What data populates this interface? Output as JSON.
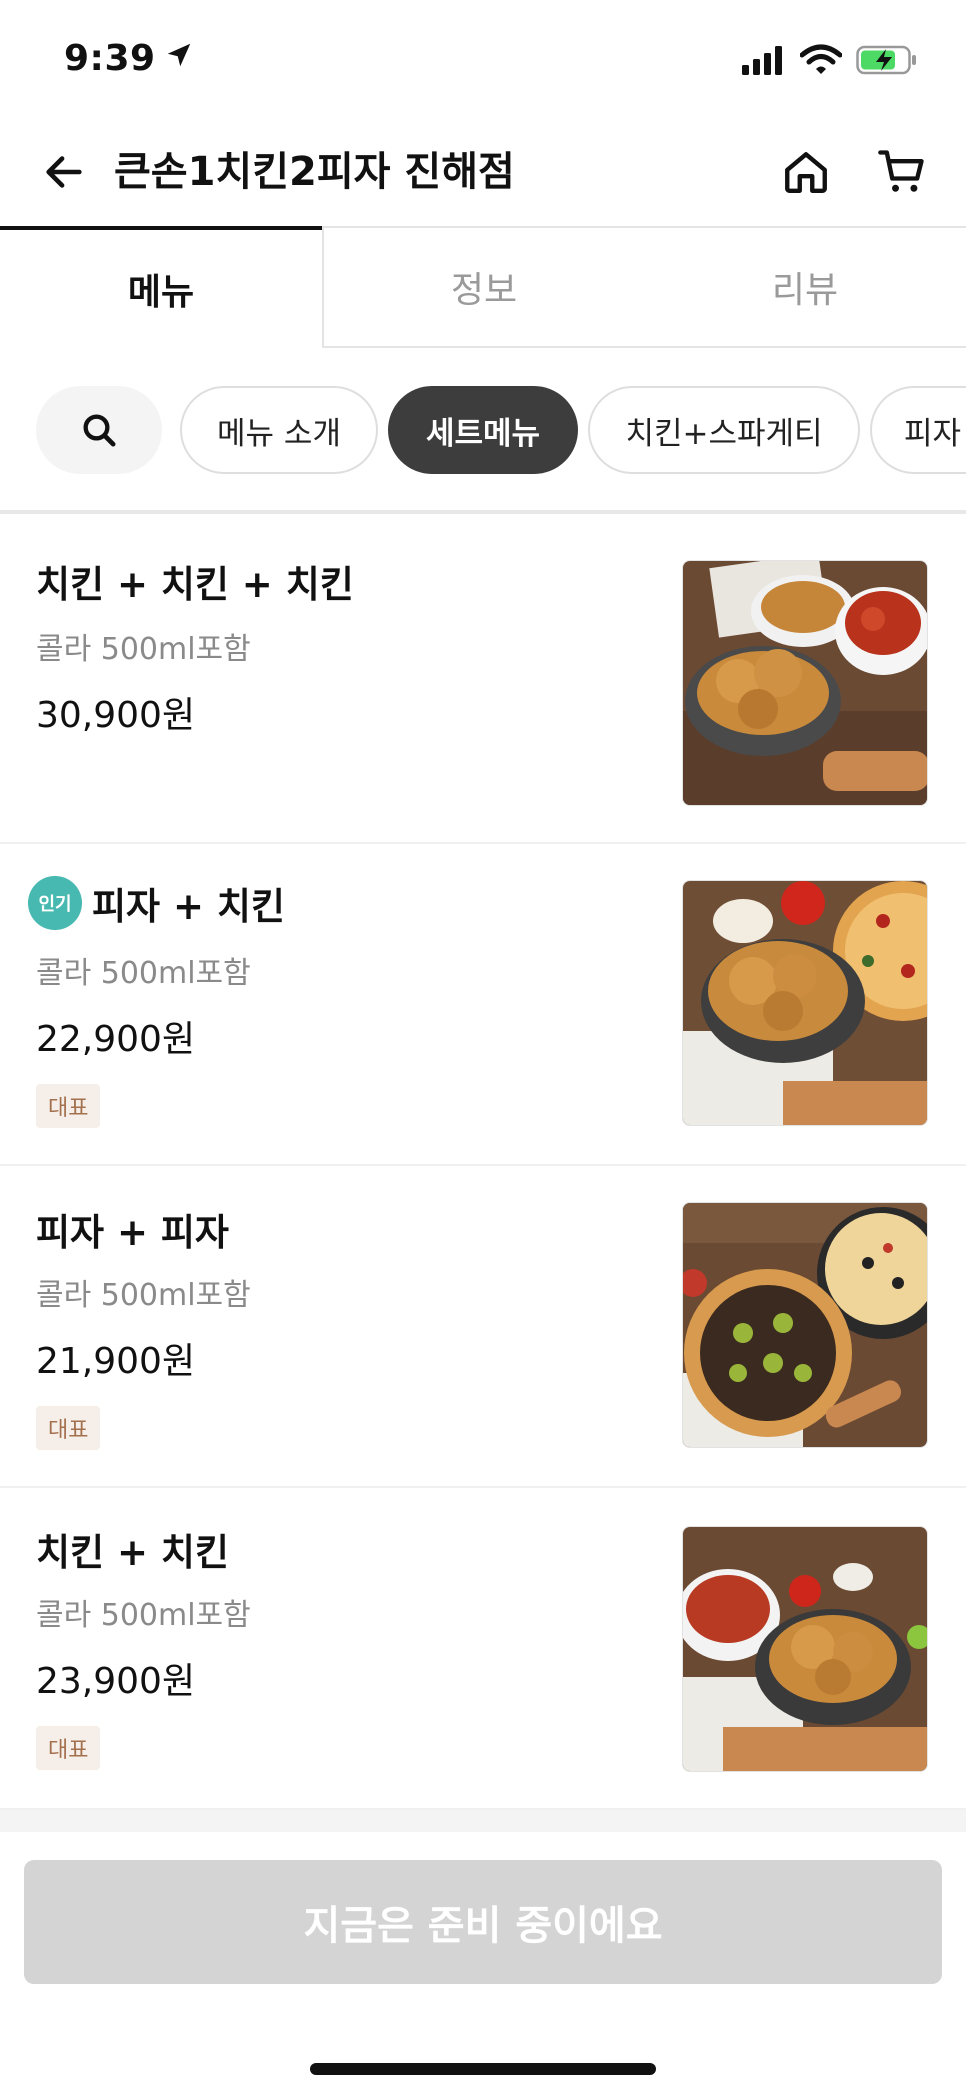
{
  "status_bar": {
    "time": "9:39",
    "icons": [
      "location-arrow-icon",
      "signal-icon",
      "wifi-icon",
      "battery-charging-icon"
    ]
  },
  "header": {
    "title": "큰손1치킨2피자 진해점",
    "icons": [
      "back-arrow-icon",
      "home-icon",
      "cart-icon"
    ]
  },
  "tabs": [
    {
      "label": "메뉴",
      "active": true
    },
    {
      "label": "정보",
      "active": false
    },
    {
      "label": "리뷰",
      "active": false
    }
  ],
  "categories": {
    "search_icon": "search-icon",
    "items": [
      {
        "label": "메뉴 소개",
        "active": false
      },
      {
        "label": "세트메뉴",
        "active": true
      },
      {
        "label": "치킨+스파게티",
        "active": false
      },
      {
        "label": "피자",
        "active": false
      }
    ]
  },
  "menu_items": [
    {
      "name": "치킨 + 치킨 + 치킨",
      "description": "콜라 500ml포함",
      "price": "30,900원",
      "badge": "",
      "popular": ""
    },
    {
      "name": "피자 + 치킨",
      "description": "콜라 500ml포함",
      "price": "22,900원",
      "badge": "대표",
      "popular": "인기"
    },
    {
      "name": "피자 + 피자",
      "description": "콜라 500ml포함",
      "price": "21,900원",
      "badge": "대표",
      "popular": ""
    },
    {
      "name": "치킨 + 치킨",
      "description": "콜라 500ml포함",
      "price": "23,900원",
      "badge": "대표",
      "popular": ""
    }
  ],
  "footer": {
    "order_button_label": "지금은 준비 중이에요"
  },
  "colors": {
    "active_chip": "#3d3d3d",
    "popular_badge": "#47b9b0",
    "rep_badge_bg": "#f6efe9",
    "rep_badge_text": "#a4714f",
    "disabled_button": "#d4d4d4"
  }
}
